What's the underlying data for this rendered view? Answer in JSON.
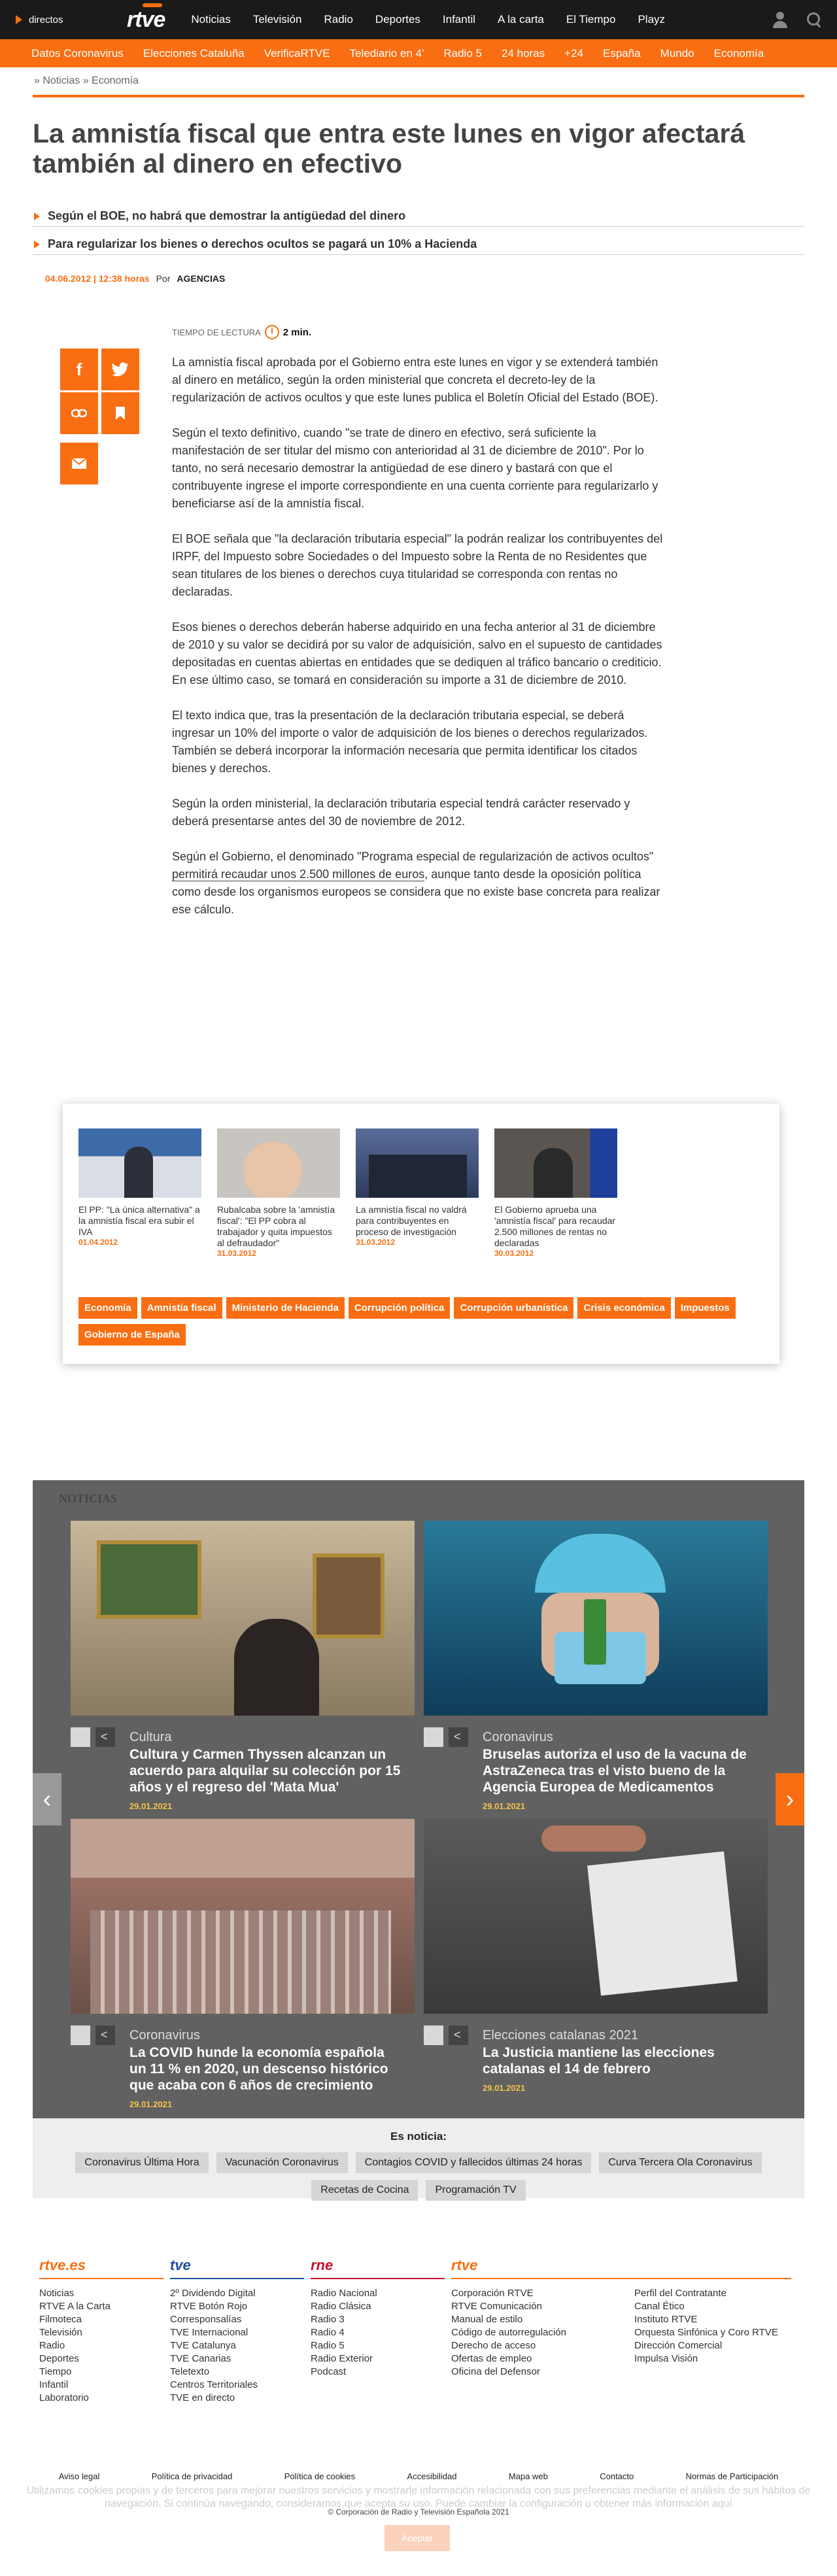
{
  "topbar": {
    "live": "directos",
    "logo": "rtve",
    "nav": [
      "Noticias",
      "Televisión",
      "Radio",
      "Deportes",
      "Infantil",
      "A la carta",
      "El Tiempo",
      "Playz"
    ]
  },
  "subnav": [
    "Datos Coronavirus",
    "Elecciones Cataluña",
    "VerificaRTVE",
    "Telediario en 4'",
    "Radio 5",
    "24 horas",
    "+24",
    "España",
    "Mundo",
    "Economía"
  ],
  "breadcrumb": "» Noticias » Economía",
  "article": {
    "title": "La amnistía fiscal que entra este lunes en vigor afectará también al dinero en efectivo",
    "summary": [
      "Según el BOE, no habrá que demostrar la antigüedad del dinero",
      "Para regularizar los bienes o derechos ocultos se pagará un 10% a Hacienda"
    ],
    "date": "04.06.2012 | 12:38 horas",
    "by": "Por",
    "agency": "AGENCIAS",
    "reading_label": "TIEMPO DE LECTURA",
    "reading_time": "2 min.",
    "paragraphs": [
      "La amnistía fiscal aprobada por el Gobierno entra este lunes en vigor y se extenderá también al dinero en metálico, según la orden ministerial que concreta el decreto-ley de la regularización de activos ocultos y que este lunes publica el Boletín Oficial del Estado (BOE).",
      "Según el texto definitivo, cuando \"se trate de dinero en efectivo, será suficiente la manifestación de ser titular del mismo con anterioridad al 31 de diciembre de 2010\". Por lo tanto, no será necesario demostrar la antigüedad de ese dinero y bastará con que el contribuyente ingrese el importe correspondiente en una cuenta corriente para regularizarlo y beneficiarse así de la amnistía fiscal.",
      "El BOE señala que \"la declaración tributaria especial\" la podrán realizar los contribuyentes del IRPF, del Impuesto sobre Sociedades o del Impuesto sobre la Renta de no Residentes que sean titulares de los bienes o derechos cuya titularidad se corresponda con rentas no declaradas.",
      "Esos bienes o derechos deberán haberse adquirido en una fecha anterior al 31 de diciembre de 2010 y su valor se decidirá por su valor de adquisición, salvo en el supuesto de cantidades depositadas en cuentas abiertas en entidades que se dediquen al tráfico bancario o crediticio. En ese último caso, se tomará en consideración su importe a 31 de diciembre de 2010.",
      "El texto indica que, tras la presentación de la declaración tributaria especial, se deberá ingresar un 10% del importe o valor de adquisición de los bienes o derechos regularizados. También se deberá incorporar la información necesaria que permita identificar los citados bienes y derechos.",
      "Según la orden ministerial, la declaración tributaria especial tendrá carácter reservado y deberá presentarse antes del 30 de noviembre de 2012."
    ],
    "last_pre": "Según el Gobierno, el denominado \"Programa especial de regularización de activos ocultos\" ",
    "last_link": "permitirá recaudar unos 2.500 millones de euros",
    "last_post": ", aunque tanto desde la oposición política como desde los organismos europeos se considera que no existe base concreta para realizar ese cálculo."
  },
  "related": [
    {
      "title": "El PP: \"La única alternativa\" a la amnistía fiscal era subir el IVA",
      "date": "01.04.2012"
    },
    {
      "title": "Rubalcaba sobre la 'amnistía fiscal': \"El PP cobra al trabajador y quita impuestos al defraudador\"",
      "date": "31.03.2012"
    },
    {
      "title": "La amnistía fiscal no valdrá para contribuyentes en proceso de investigación",
      "date": "31.03.2012"
    },
    {
      "title": "El Gobierno aprueba una 'amnistía fiscal' para recaudar 2.500 millones de rentas no declaradas",
      "date": "30.03.2012"
    }
  ],
  "tags": [
    "Economía",
    "Amnistía fiscal",
    "Ministerio de Hacienda",
    "Corrupción política",
    "Corrupción urbanística",
    "Crisis económica",
    "Impuestos",
    "Gobierno de España"
  ],
  "news": {
    "heading": "NOTICIAS",
    "cards": [
      {
        "category": "Cultura",
        "headline": "Cultura y Carmen Thyssen alcanzan un acuerdo para alquilar su colección por 15 años y el regreso del 'Mata Mua'",
        "date": "29.01.2021"
      },
      {
        "category": "Coronavirus",
        "headline": "Bruselas autoriza el uso de la vacuna de AstraZeneca tras el visto bueno de la Agencia Europea de Medicamentos",
        "date": "29.01.2021"
      },
      {
        "category": "Coronavirus",
        "headline": "La COVID hunde la economía española un 11 % en 2020, un descenso histórico que acaba con 6 años de crecimiento",
        "date": "29.01.2021"
      },
      {
        "category": "Elecciones catalanas 2021",
        "headline": "La Justicia mantiene las elecciones catalanas el 14 de febrero",
        "date": "29.01.2021"
      }
    ]
  },
  "es_noticia": {
    "heading": "Es noticia:",
    "chips": [
      "Coronavirus Última Hora",
      "Vacunación Coronavirus",
      "Contagios COVID y fallecidos últimas 24 horas",
      "Curva Tercera Ola Coronavirus",
      "Recetas de Cocina",
      "Programación TV"
    ]
  },
  "footer": {
    "cols": [
      {
        "logo": "rtve.es",
        "items": [
          "Noticias",
          "RTVE A la Carta",
          "Filmoteca",
          "Televisión",
          "Radio",
          "Deportes",
          "Tiempo",
          "Infantil",
          "Laboratorio"
        ]
      },
      {
        "logo": "tve",
        "items": [
          "2º Dividendo Digital",
          "RTVE Botón Rojo",
          "Corresponsalías",
          "TVE Internacional",
          "TVE Catalunya",
          "TVE Canarias",
          "Teletexto",
          "Centros Territoriales",
          "TVE en directo"
        ]
      },
      {
        "logo": "rne",
        "items": [
          "Radio Nacional",
          "Radio Clásica",
          "Radio 3",
          "Radio 4",
          "Radio 5",
          "Radio Exterior",
          "Podcast"
        ]
      },
      {
        "logo": "rtve",
        "items": [
          "Corporación RTVE",
          "RTVE Comunicación",
          "Manual de estilo",
          "Código de autorregulación",
          "Derecho de acceso",
          "Ofertas de empleo",
          "Oficina del Defensor"
        ]
      },
      {
        "logo": "",
        "items": [
          "Perfil del Contratante",
          "Canal Ético",
          "Instituto RTVE",
          "Orquesta Sinfónica y Coro RTVE",
          "Dirección Comercial",
          "Impulsa Visión"
        ]
      }
    ],
    "legal": [
      "Aviso legal",
      "Política de privacidad",
      "Política de cookies",
      "Accesibilidad",
      "Mapa web",
      "Contacto",
      "Normas de Participación"
    ],
    "cookie_text": "Utilizamos cookies propias y de terceros para mejorar nuestros servicios y mostrarle información relacionada con sus preferencias mediante el análisis de sus hábitos de navegación. Si continúa navegando, consideramos que acepta su uso. Puede cambiar la configuración u obtener más información aquí",
    "cookie_button": "Aceptar",
    "copyright": "© Corporación de Radio y Televisión Española 2021"
  },
  "colors": {
    "accent": "#f96e12",
    "dark": "#1a1a1a",
    "news_bg": "#616161"
  }
}
